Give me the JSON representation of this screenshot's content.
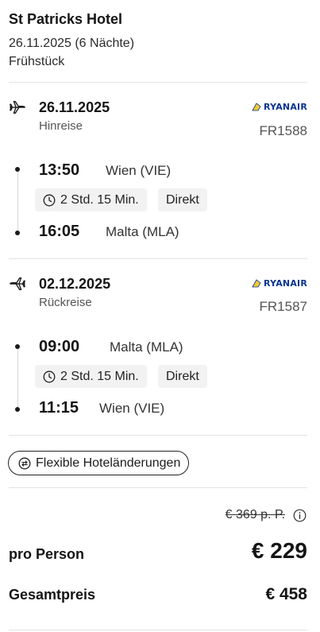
{
  "hotel": {
    "name": "St Patricks Hotel",
    "dates": "26.11.2025 (6 Nächte)",
    "board": "Frühstück"
  },
  "outbound": {
    "date": "26.11.2025",
    "direction": "Hinreise",
    "airline": "RYANAIR",
    "flight_number": "FR1588",
    "departure_time": "13:50",
    "departure_place": "Wien (VIE)",
    "duration": "2 Std. 15 Min.",
    "stops": "Direkt",
    "arrival_time": "16:05",
    "arrival_place": "Malta (MLA)"
  },
  "return": {
    "date": "02.12.2025",
    "direction": "Rückreise",
    "airline": "RYANAIR",
    "flight_number": "FR1587",
    "departure_time": "09:00",
    "departure_place": "Malta (MLA)",
    "duration": "2 Std. 15 Min.",
    "stops": "Direkt",
    "arrival_time": "11:15",
    "arrival_place": "Wien (VIE)"
  },
  "flex_button": {
    "label": "Flexible Hoteländerungen",
    "icon": "swap-circle-icon"
  },
  "pricing": {
    "old_price": "€ 369 p. P.",
    "per_person_label": "pro Person",
    "per_person_value": "€ 229",
    "total_label": "Gesamtpreis",
    "total_value": "€ 458"
  },
  "colors": {
    "ryanair_blue": "#073590",
    "ryanair_yellow": "#f1c933",
    "chip_bg": "#f2f2f2"
  }
}
